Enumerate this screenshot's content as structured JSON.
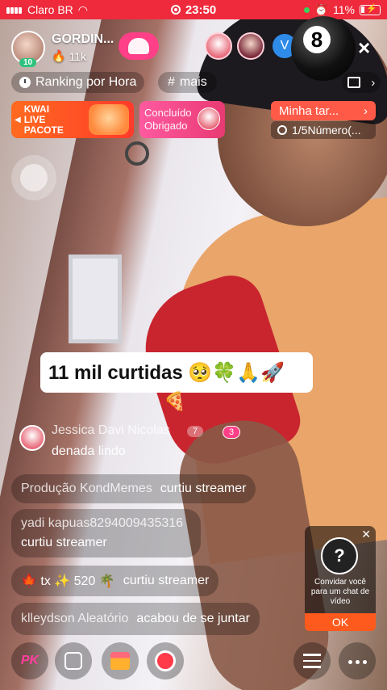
{
  "status_bar": {
    "carrier": "Claro BR",
    "time": "23:50",
    "battery": "11%"
  },
  "host": {
    "name": "GORDIN...",
    "level": "10",
    "likes": "11k"
  },
  "viewers": {
    "letter_avatar": "V"
  },
  "overlay": {
    "ball_number": "8",
    "close_symbol": "×"
  },
  "ranking": {
    "label": "Ranking por Hora",
    "hashtag_symbol": "#",
    "hashtag_label": "mais",
    "chevron": "›"
  },
  "banners": {
    "kwai_line1": "KWAI",
    "kwai_line2": "LIVE",
    "kwai_line3": "PACOTE",
    "thanks_line1": "Concluído",
    "thanks_line2": "Obrigado"
  },
  "task": {
    "title": "Minha tar...",
    "chevron": "›",
    "progress_text": "1/5Número(..."
  },
  "toast": {
    "text": "11 mil curtidas 🥺🍀🙏🚀",
    "emoji_line": "🍕"
  },
  "chat": {
    "first": {
      "name": "Jessica Davi Nicolas",
      "level": "7",
      "fans": "3",
      "text": "denada lindo"
    },
    "items": [
      {
        "name": "Produção KondMemes",
        "text": "curtiu streamer"
      },
      {
        "name": "yadi kapuas8294009435316",
        "text": "curtiu streamer"
      },
      {
        "name": "🍁 tx ✨ 520 🌴",
        "text": "curtiu streamer"
      },
      {
        "name": "klleydson Aleatório",
        "text": "acabou de se juntar"
      }
    ]
  },
  "invite": {
    "avatar_symbol": "?",
    "text": "Convidar você para um chat de vídeo",
    "ok_label": "OK"
  },
  "bottom": {
    "pk_label": "PK"
  }
}
